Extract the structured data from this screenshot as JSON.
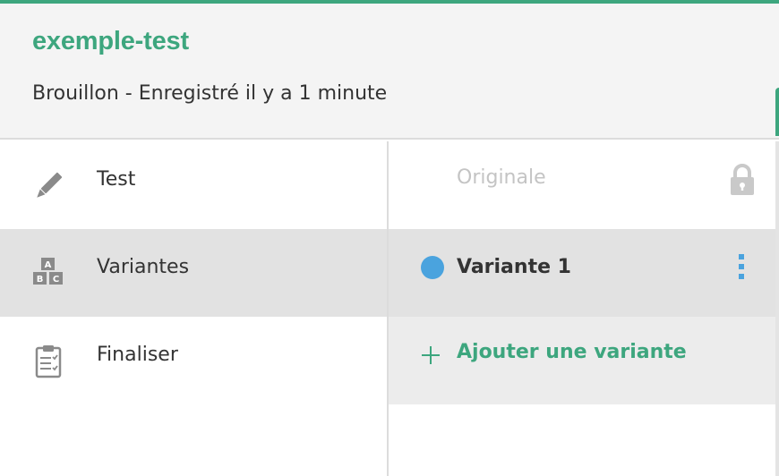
{
  "colors": {
    "accent": "#3da67e",
    "variant": "#4aa3de",
    "muted": "#c4c4c4"
  },
  "header": {
    "title": "exemple-test",
    "status": "Brouillon - Enregistré il y a 1 minute"
  },
  "nav": {
    "items": [
      {
        "label": "Test",
        "icon": "pencil-icon",
        "active": false
      },
      {
        "label": "Variantes",
        "icon": "abc-blocks-icon",
        "active": true
      },
      {
        "label": "Finaliser",
        "icon": "clipboard-checklist-icon",
        "active": false
      }
    ]
  },
  "variants": {
    "original_label": "Originale",
    "original_icon": "lock-icon",
    "items": [
      {
        "label": "Variante 1",
        "color": "#4aa3de"
      }
    ],
    "menu_icon": "kebab-menu-icon",
    "add_label": "Ajouter une variante",
    "add_icon": "plus-icon"
  }
}
